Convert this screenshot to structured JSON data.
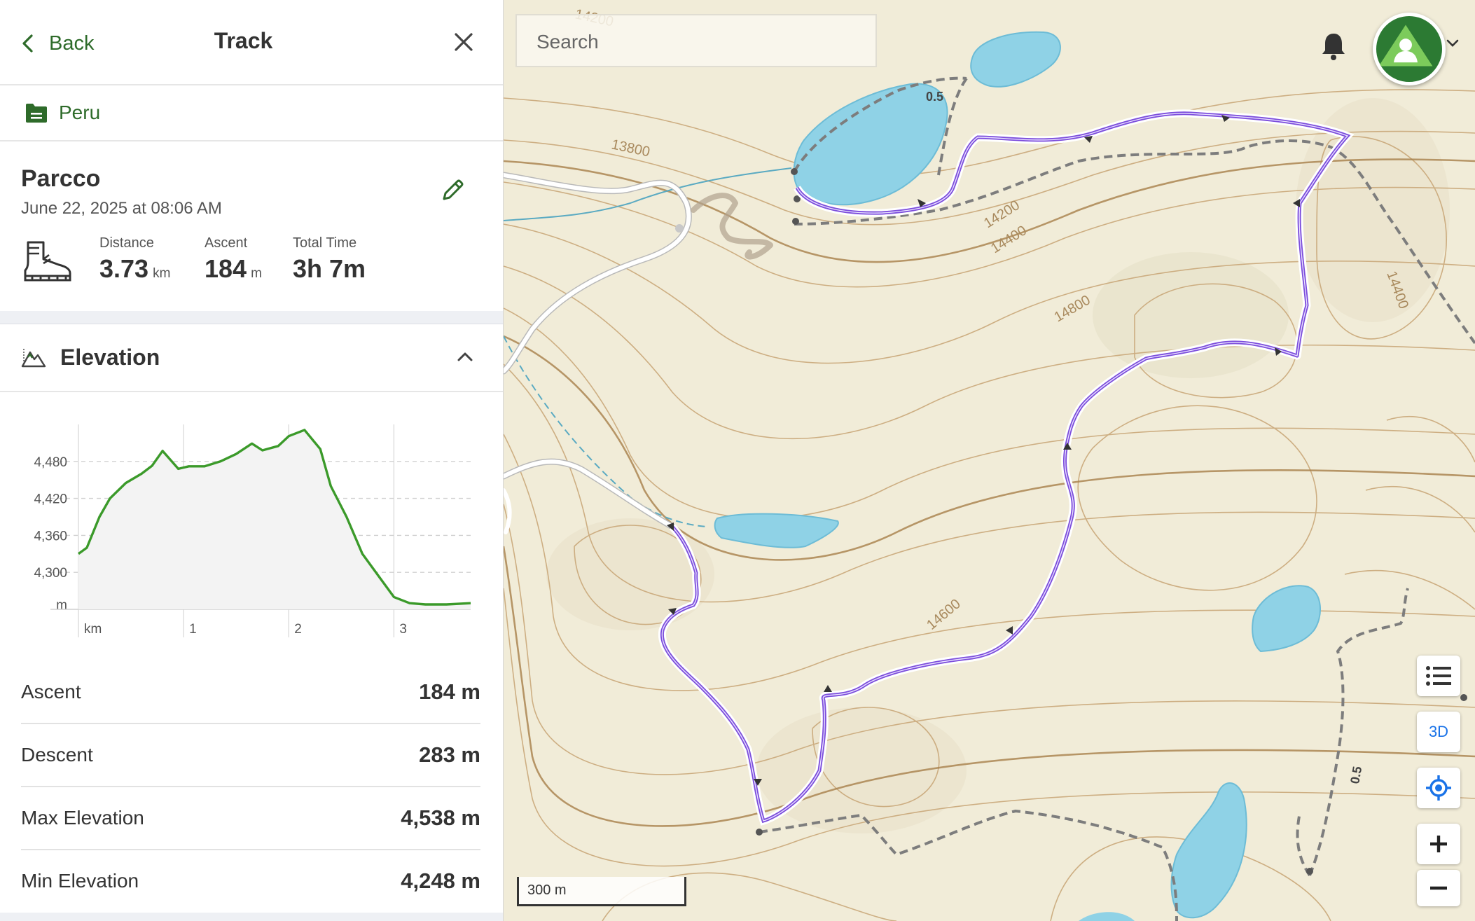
{
  "header": {
    "back_label": "Back",
    "title": "Track"
  },
  "folder": {
    "name": "Peru"
  },
  "track": {
    "name": "Parcco",
    "date": "June 22, 2025 at 08:06 AM",
    "stats": [
      {
        "label": "Distance",
        "value": "3.73",
        "unit": "km"
      },
      {
        "label": "Ascent",
        "value": "184",
        "unit": "m"
      },
      {
        "label": "Total Time",
        "value": "3h 7m",
        "unit": ""
      }
    ]
  },
  "elevation": {
    "title": "Elevation",
    "summary": [
      {
        "label": "Ascent",
        "value": "184 m"
      },
      {
        "label": "Descent",
        "value": "283 m"
      },
      {
        "label": "Max Elevation",
        "value": "4,538 m"
      },
      {
        "label": "Min Elevation",
        "value": "4,248 m"
      }
    ]
  },
  "chart_data": {
    "type": "line",
    "y_unit": "m",
    "x_unit": "km",
    "y_ticks": [
      "4,480",
      "4,420",
      "4,360",
      "4,300"
    ],
    "y_tick_values": [
      4480,
      4420,
      4360,
      4300
    ],
    "x_ticks": [
      "km",
      "1",
      "2",
      "3"
    ],
    "x_tick_values": [
      0,
      1,
      2,
      3
    ],
    "ylim": [
      4240,
      4540
    ],
    "xlim": [
      0,
      3.73
    ],
    "series": [
      {
        "x": [
          0,
          0.08,
          0.2,
          0.3,
          0.45,
          0.6,
          0.7,
          0.8,
          0.95,
          1.05,
          1.2,
          1.35,
          1.5,
          1.65,
          1.75,
          1.9,
          2.0,
          2.15,
          2.3,
          2.4,
          2.55,
          2.7,
          2.85,
          3.0,
          3.15,
          3.3,
          3.5,
          3.73
        ],
        "y": [
          4330,
          4340,
          4390,
          4420,
          4445,
          4460,
          4473,
          4497,
          4468,
          4472,
          4472,
          4480,
          4492,
          4509,
          4498,
          4505,
          4521,
          4531,
          4500,
          4440,
          4390,
          4330,
          4295,
          4260,
          4250,
          4248,
          4248,
          4250
        ]
      }
    ],
    "grid": true,
    "color": "#3b9a2a"
  },
  "map": {
    "search_placeholder": "Search",
    "contour_labels": [
      "13800",
      "14200",
      "14400",
      "14800",
      "14600",
      "14400",
      "14200"
    ],
    "trail_marks": [
      "0.5",
      "0.5"
    ],
    "view_3d_label": "3D",
    "scale_label": "300 m"
  },
  "colors": {
    "accent": "#2e6b2a",
    "track": "#7c4ddc",
    "water": "#8fd2e6",
    "contour": "#b58b55"
  }
}
